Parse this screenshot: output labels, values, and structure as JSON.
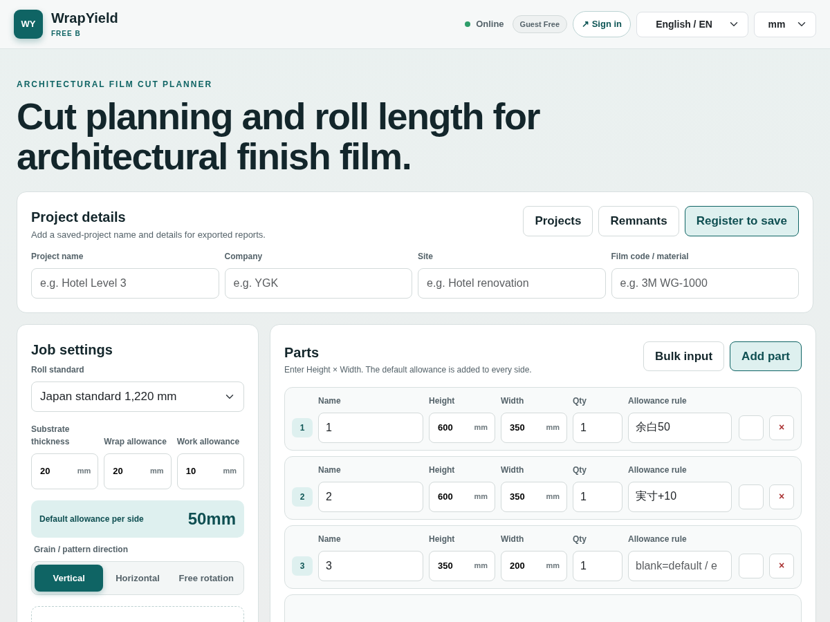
{
  "header": {
    "logo": "WY",
    "brand": "WrapYield",
    "plan": "FREE B",
    "status": {
      "label": "Online",
      "online": true
    },
    "badge": "Guest Free",
    "sign_in": {
      "icon": "↗",
      "label": "Sign in"
    },
    "language": "English / EN",
    "unit": "mm"
  },
  "hero": {
    "eyebrow": "ARCHITECTURAL FILM CUT PLANNER",
    "title": "Cut planning and roll length for architectural finish film."
  },
  "project": {
    "title": "Project details",
    "subtitle": "Add a saved-project name and details for exported reports.",
    "buttons": [
      {
        "label": "Projects",
        "primary": false
      },
      {
        "label": "Remnants",
        "primary": false
      },
      {
        "label": "Register to save",
        "primary": true
      }
    ],
    "fields": [
      {
        "label": "Project name",
        "placeholder": "e.g. Hotel Level 3"
      },
      {
        "label": "Company",
        "placeholder": "e.g. YGK"
      },
      {
        "label": "Site",
        "placeholder": "e.g. Hotel renovation"
      },
      {
        "label": "Film code / material",
        "placeholder": "e.g. 3M WG-1000"
      }
    ]
  },
  "job_settings": {
    "title": "Job settings",
    "roll_label": "Roll standard",
    "roll": "Japan standard 1,220 mm",
    "allowances": [
      {
        "label": "Substrate thickness",
        "value": "20",
        "unit": "mm"
      },
      {
        "label": "Wrap allowance",
        "value": "20",
        "unit": "mm"
      },
      {
        "label": "Work allowance",
        "value": "10",
        "unit": "mm"
      }
    ],
    "default_allowance": {
      "label": "Default allowance per side",
      "value": "50mm"
    },
    "grain_label": "Grain / pattern direction",
    "grain_options": [
      {
        "label": "Vertical",
        "selected": true
      },
      {
        "label": "Horizontal",
        "selected": false
      },
      {
        "label": "Free rotation",
        "selected": false
      }
    ]
  },
  "parts": {
    "title": "Parts",
    "subtitle": "Enter Height × Width. The default allowance is added to every side.",
    "buttons": [
      {
        "label": "Bulk input",
        "primary": false
      },
      {
        "label": "Add part",
        "primary": true
      }
    ],
    "rows": [
      {
        "index": "1",
        "fields": [
          {
            "label": "Name",
            "value": "1"
          },
          {
            "label": "Height",
            "value": "600",
            "unit": "mm"
          },
          {
            "label": "Width",
            "value": "350",
            "unit": "mm"
          },
          {
            "label": "Qty",
            "value": "1"
          },
          {
            "label": "Allowance rule",
            "value": "余白50"
          }
        ],
        "remove": "×"
      },
      {
        "index": "2",
        "fields": [
          {
            "label": "Name",
            "value": "2"
          },
          {
            "label": "Height",
            "value": "600",
            "unit": "mm"
          },
          {
            "label": "Width",
            "value": "350",
            "unit": "mm"
          },
          {
            "label": "Qty",
            "value": "1"
          },
          {
            "label": "Allowance rule",
            "value": "実寸+10"
          }
        ],
        "remove": "×"
      },
      {
        "index": "3",
        "fields": [
          {
            "label": "Name",
            "value": "3"
          },
          {
            "label": "Height",
            "value": "350",
            "unit": "mm"
          },
          {
            "label": "Width",
            "value": "200",
            "unit": "mm"
          },
          {
            "label": "Qty",
            "value": "1"
          },
          {
            "label": "Allowance rule",
            "placeholder": "blank=default / e"
          }
        ],
        "remove": "×"
      }
    ]
  }
}
